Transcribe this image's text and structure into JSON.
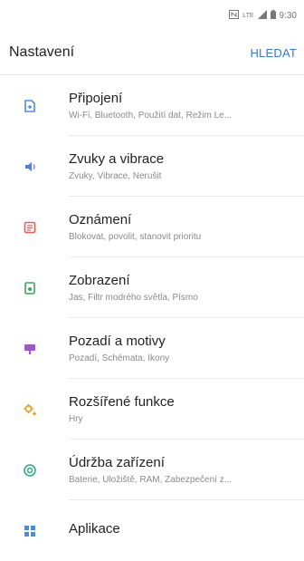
{
  "status_bar": {
    "time": "9:30",
    "icons": [
      "nfc-icon",
      "lte-icon",
      "signal-icon",
      "battery-icon"
    ],
    "lte_label": "LTE"
  },
  "header": {
    "title": "Nastavení",
    "search_label": "HLEDAT",
    "search_color": "#3a78c9"
  },
  "settings": {
    "items": [
      {
        "title": "Připojení",
        "subtitle": "Wi-Fi, Bluetooth, Použití dat, Režim Le...",
        "icon": "connections-icon",
        "color": "#4a8de0"
      },
      {
        "title": "Zvuky a vibrace",
        "subtitle": "Zvuky, Vibrace, Nerušit",
        "icon": "sound-icon",
        "color": "#5b7bd6"
      },
      {
        "title": "Oznámení",
        "subtitle": "Blokovat, povolit, stanovit prioritu",
        "icon": "notifications-icon",
        "color": "#e45d5d"
      },
      {
        "title": "Zobrazení",
        "subtitle": "Jas, Filtr modrého světla, Písmo",
        "icon": "display-icon",
        "color": "#3ea35a"
      },
      {
        "title": "Pozadí a motivy",
        "subtitle": "Pozadí, Schémata, Ikony",
        "icon": "wallpaper-icon",
        "color": "#9b59c9"
      },
      {
        "title": "Rozšířené funkce",
        "subtitle": "Hry",
        "icon": "advanced-features-icon",
        "color": "#e8a020"
      },
      {
        "title": "Údržba zařízení",
        "subtitle": "Baterie, Úložiště, RAM, Zabezpečení z...",
        "icon": "device-maintenance-icon",
        "color": "#2fae8e"
      },
      {
        "title": "Aplikace",
        "subtitle": "",
        "icon": "apps-icon",
        "color": "#4a8de0"
      }
    ]
  }
}
